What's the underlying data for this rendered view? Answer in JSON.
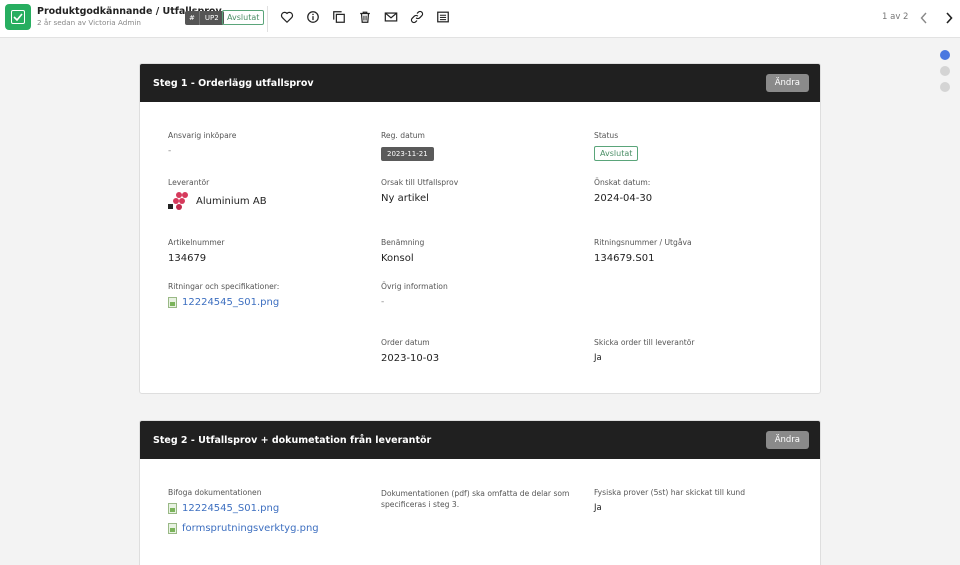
{
  "header": {
    "title": "Produktgodkännande / Utfallsprov",
    "subtitle": "2 år sedan av Victoria Admin",
    "tag_hash": "#",
    "tag_code": "UP2",
    "status": "Avslutat",
    "pager": "1 av 2"
  },
  "toolbar_icons": [
    "heart-icon",
    "info-icon",
    "copy-icon",
    "trash-icon",
    "mail-icon",
    "link-icon",
    "list-icon"
  ],
  "step1": {
    "title": "Steg 1 - Orderlägg utfallsprov",
    "edit_label": "Ändra",
    "ansvarig_label": "Ansvarig inköpare",
    "ansvarig_value": "-",
    "reg_label": "Reg. datum",
    "reg_value": "2023-11-21",
    "status_label": "Status",
    "status_value": "Avslutat",
    "leverantor_label": "Leverantör",
    "leverantor_value": "Aluminium AB",
    "orsak_label": "Orsak till Utfallsprov",
    "orsak_value": "Ny artikel",
    "onskat_label": "Önskat datum:",
    "onskat_value": "2024-04-30",
    "artikel_label": "Artikelnummer",
    "artikel_value": "134679",
    "benamning_label": "Benämning",
    "benamning_value": "Konsol",
    "ritning_label": "Ritningsnummer / Utgåva",
    "ritning_value": "134679.S01",
    "spec_label": "Ritningar och specifikationer:",
    "spec_file": "12224545_S01.png",
    "ovrig_label": "Övrig information",
    "ovrig_value": "-",
    "order_label": "Order datum",
    "order_value": "2023-10-03",
    "skicka_label": "Skicka order till leverantör",
    "skicka_value": "Ja"
  },
  "step2": {
    "title": "Steg 2 - Utfallsprov + dokumetation från leverantör",
    "edit_label": "Ändra",
    "bifoga_label": "Bifoga dokumentationen",
    "file1": "12224545_S01.png",
    "file2": "formsprutningsverktyg.png",
    "dok_line1": "Dokumentationen (pdf) ska omfatta de delar som",
    "dok_line2": "specificeras i steg 3.",
    "fysiska_label": "Fysiska prover (5st) har skickat till kund",
    "fysiska_value": "Ja"
  }
}
